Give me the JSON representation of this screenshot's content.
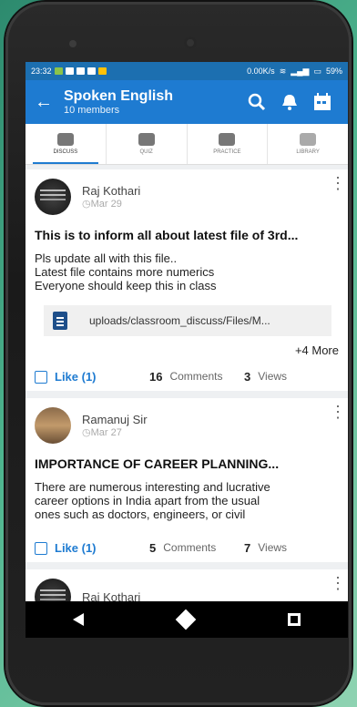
{
  "status": {
    "time": "23:32",
    "speed": "0.00K/s",
    "battery": "59%"
  },
  "header": {
    "title": "Spoken English",
    "subtitle": "10 members"
  },
  "tabs": [
    {
      "label": "DISCUSS"
    },
    {
      "label": "QUIZ"
    },
    {
      "label": "PRACTICE"
    },
    {
      "label": "LIBRARY"
    }
  ],
  "posts": [
    {
      "author": "Raj Kothari",
      "date": "Mar 29",
      "title": "This is to inform all about latest file of 3rd...",
      "body": [
        "Pls update all with this file..",
        "Latest file contains more numerics",
        "Everyone should keep this in class"
      ],
      "attachment": "uploads/classroom_discuss/Files/M...",
      "more": "+4  More",
      "like": "Like (1)",
      "comments_count": "16",
      "comments_label": "Comments",
      "views_count": "3",
      "views_label": "Views"
    },
    {
      "author": "Ramanuj Sir",
      "date": "Mar 27",
      "title": "IMPORTANCE OF CAREER PLANNING...",
      "body": [
        "There are numerous interesting and lucrative",
        "career options in India apart from the usual",
        "ones such as doctors, engineers, or civil"
      ],
      "like": "Like (1)",
      "comments_count": "5",
      "comments_label": "Comments",
      "views_count": "7",
      "views_label": "Views"
    },
    {
      "author": "Raj Kothari"
    }
  ]
}
